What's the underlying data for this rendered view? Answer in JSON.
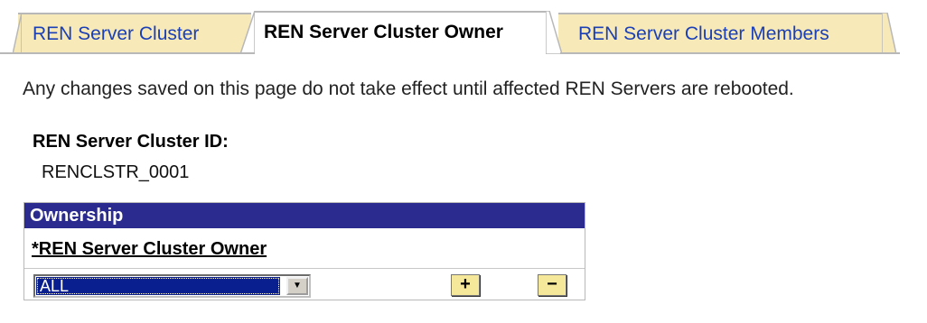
{
  "tabs": [
    {
      "label": "REN Server Cluster",
      "state": "inactive"
    },
    {
      "label": "REN Server Cluster Owner",
      "state": "active"
    },
    {
      "label": "REN Server Cluster Members",
      "state": "inactive"
    }
  ],
  "notice": "Any changes saved on this page do not take effect until affected REN Servers are rebooted.",
  "cluster": {
    "id_label": "REN Server Cluster ID:",
    "id_value": "RENCLSTR_0001"
  },
  "ownership": {
    "title": "Ownership",
    "column_header": "*REN Server Cluster Owner",
    "owner_value": "ALL",
    "add_label": "+",
    "remove_label": "−"
  },
  "colors": {
    "tab_inactive_bg": "#f7e9b8",
    "tab_link": "#1a3fb7",
    "grid_header_bg": "#2b2b8f",
    "select_highlight": "#0a1f8f",
    "button_bg": "#f6e89a"
  }
}
